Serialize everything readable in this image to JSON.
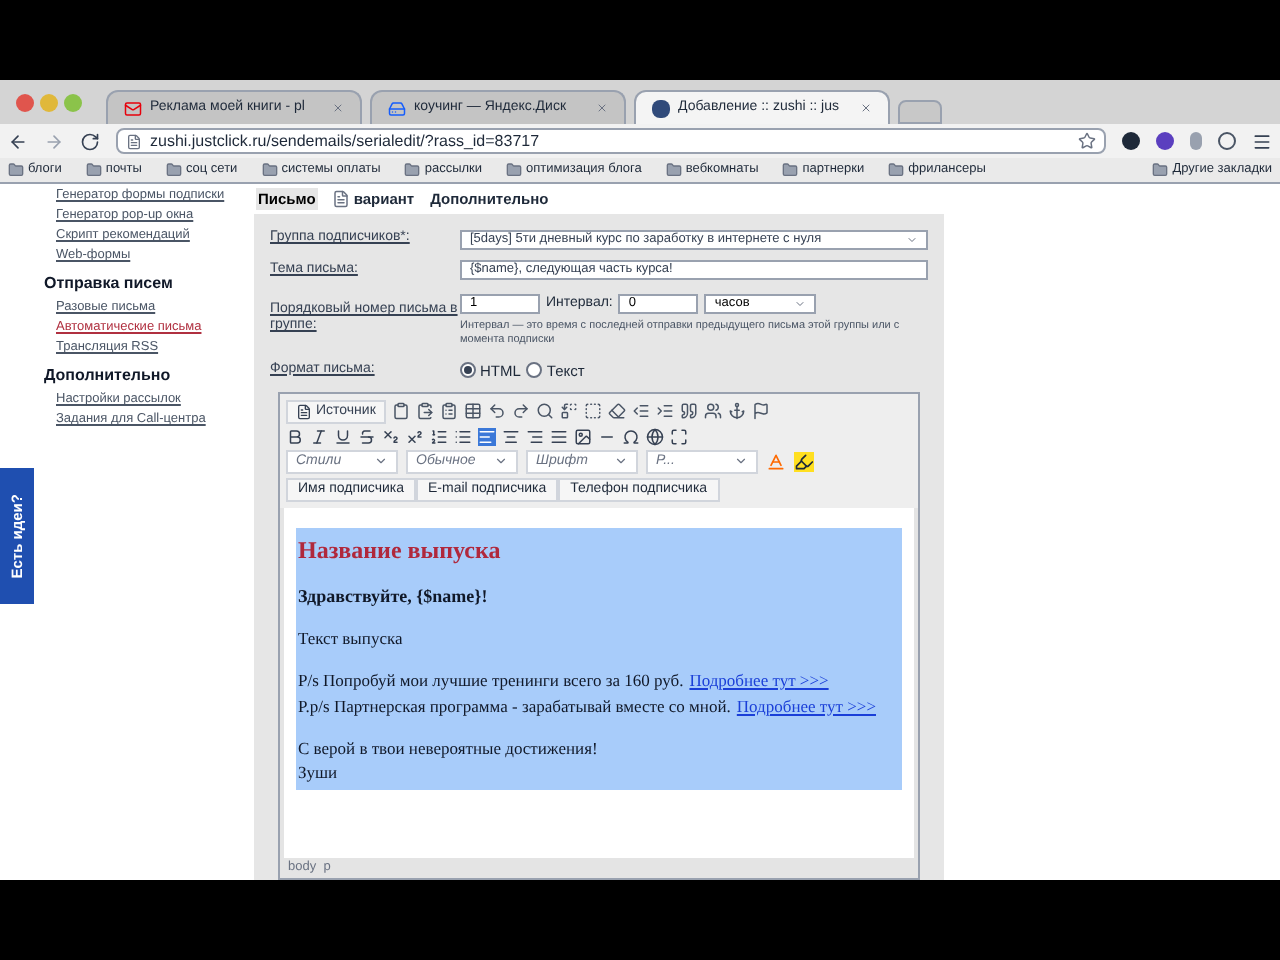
{
  "browser": {
    "tabs": [
      {
        "label": "Реклама моей книги - pl",
        "selected": false
      },
      {
        "label": "коучинг — Яндекс.Диск",
        "selected": false
      },
      {
        "label": "Добавление :: zushi :: jus",
        "selected": true
      }
    ],
    "address": "zushi.justclick.ru/sendemails/serialedit/?rass_id=83717",
    "bookmarks": [
      "блоги",
      "почты",
      "соц сети",
      "системы оплаты",
      "рассылки",
      "оптимизация блога",
      "вебкомнаты",
      "партнерки",
      "фрилансеры"
    ],
    "other_bookmarks": "Другие закладки"
  },
  "sidebar": {
    "sections": [
      {
        "items": [
          {
            "label": "Генератор формы подписки",
            "selected": false
          },
          {
            "label": "Генератор pop-up окна",
            "selected": false
          },
          {
            "label": "Скрипт рекомендаций",
            "selected": false
          },
          {
            "label": "Web-формы",
            "selected": false
          }
        ]
      },
      {
        "title": "Отправка писем",
        "items": [
          {
            "label": "Разовые письма",
            "selected": false
          },
          {
            "label": "Автоматические письма",
            "selected": true
          },
          {
            "label": "Трансляция RSS",
            "selected": false
          }
        ]
      },
      {
        "title": "Дополнительно",
        "items": [
          {
            "label": "Настройки рассылок",
            "selected": false
          },
          {
            "label": "Задания для Call-центра",
            "selected": false
          }
        ]
      }
    ]
  },
  "feedback_tab": "Есть идеи?",
  "tabs": [
    {
      "label": "Письмо",
      "icon": false,
      "selected": true
    },
    {
      "label": "вариант",
      "icon": true,
      "selected": false
    },
    {
      "label": "Дополнительно",
      "icon": false,
      "selected": false
    }
  ],
  "form": {
    "group": {
      "label": "Группа подписчиков*:",
      "value": "[5days] 5ти дневный курс по заработку в интернете с нуля"
    },
    "subject": {
      "label": "Тема письма:",
      "value": "{$name}, следующая часть курса!"
    },
    "order": {
      "label": "Порядковый номер письма в группе:",
      "value": "1",
      "interval_label": "Интервал:",
      "interval_value": "0",
      "unit": "часов",
      "hint": "Интервал — это время с последней отправки предыдущего письма этой группы или с момента подписки"
    },
    "format": {
      "label": "Формат письма:",
      "options": [
        {
          "label": "HTML",
          "selected": true
        },
        {
          "label": "Текст",
          "selected": false
        }
      ]
    }
  },
  "editor": {
    "source_button": "Источник",
    "combos": [
      "Стили",
      "Обычное",
      "Шрифт",
      "Р..."
    ],
    "insert_buttons": [
      "Имя подписчика",
      "E-mail подписчика",
      "Телефон подписчика"
    ],
    "content": [
      {
        "kind": "heading",
        "text": "Название выпуска"
      },
      {
        "kind": "greeting",
        "text": "Здравствуйте, {$name}!"
      },
      {
        "kind": "para",
        "text": "Текст выпуска"
      },
      {
        "kind": "lines",
        "lines": [
          {
            "text": "Р/s Попробуй мои лучшие тренинги всего за 160 руб.",
            "link": "Подробнее тут >>>"
          },
          {
            "text": "P.p/s Партнерская программа - зарабатывай вместе со мной.",
            "link": "Подробнее тут >>>"
          }
        ]
      },
      {
        "kind": "para",
        "text": "С верой в твои невероятные достижения!"
      },
      {
        "kind": "signature",
        "text": "Зуши"
      }
    ],
    "status": "body  p"
  }
}
